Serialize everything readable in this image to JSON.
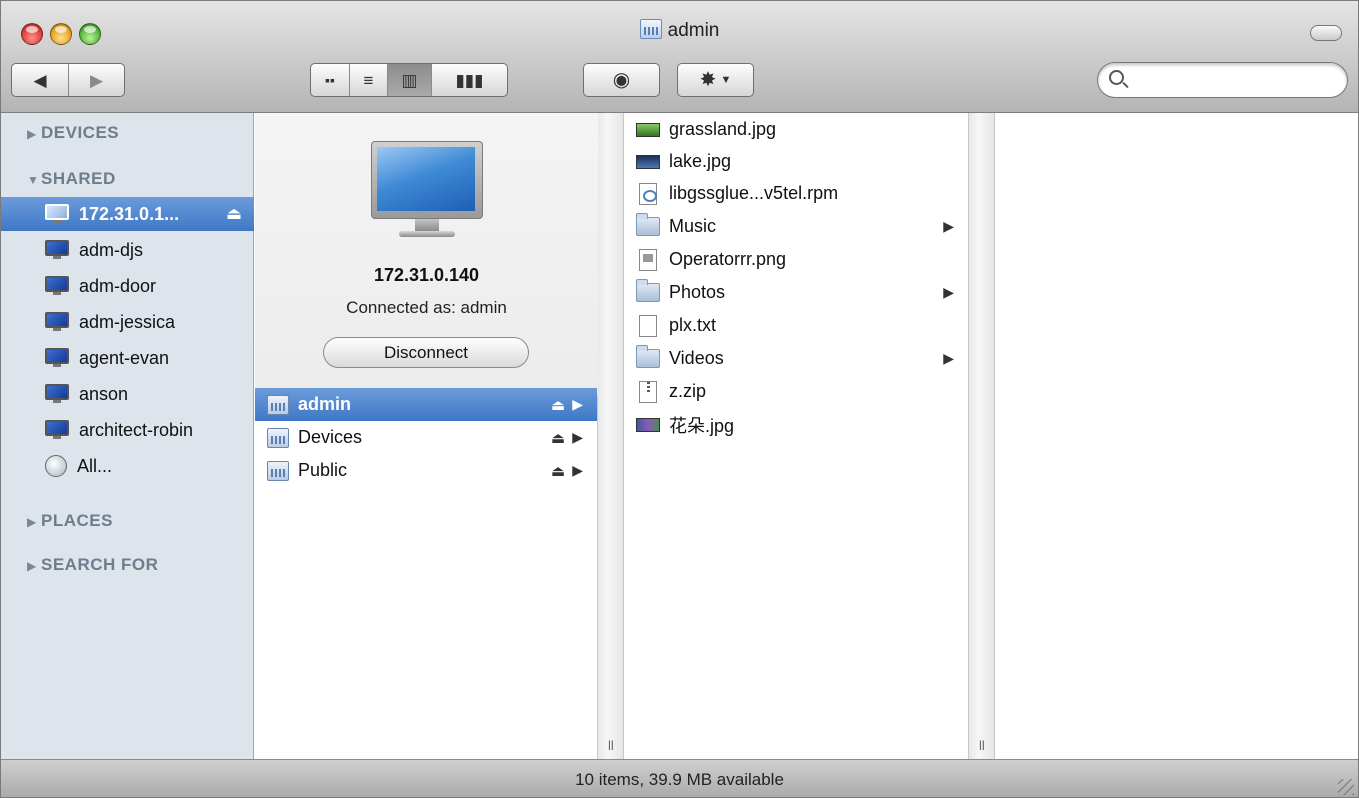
{
  "window": {
    "title": "admin"
  },
  "toolbar": {
    "back_icon": "back-arrow-icon",
    "forward_icon": "forward-arrow-icon",
    "view_icons": [
      "icon-view-icon",
      "list-view-icon",
      "column-view-icon",
      "coverflow-view-icon"
    ],
    "quicklook_icon": "eye-icon",
    "action_icon": "gear-icon",
    "search": {
      "value": "",
      "placeholder": ""
    }
  },
  "sidebar": {
    "sections": {
      "devices": "DEVICES",
      "shared": "SHARED",
      "places": "PLACES",
      "search_for": "SEARCH FOR"
    },
    "shared_items": [
      {
        "label": "172.31.0.1...",
        "selected": true
      },
      {
        "label": "adm-djs"
      },
      {
        "label": "adm-door"
      },
      {
        "label": "adm-jessica"
      },
      {
        "label": "agent-evan"
      },
      {
        "label": "anson"
      },
      {
        "label": "architect-robin"
      },
      {
        "label": "All..."
      }
    ]
  },
  "server": {
    "address": "172.31.0.140",
    "connected_as": "Connected as: admin",
    "disconnect_label": "Disconnect"
  },
  "shares": [
    {
      "label": "admin",
      "selected": true
    },
    {
      "label": "Devices"
    },
    {
      "label": "Public"
    }
  ],
  "files": [
    {
      "label": "grassland.jpg",
      "kind": "image",
      "color": "#3e8a2a"
    },
    {
      "label": "lake.jpg",
      "kind": "image",
      "color": "#1d3f7a"
    },
    {
      "label": "libgssglue...v5tel.rpm",
      "kind": "rpm"
    },
    {
      "label": "Music",
      "kind": "folder"
    },
    {
      "label": "Operatorrr.png",
      "kind": "png"
    },
    {
      "label": "Photos",
      "kind": "folder"
    },
    {
      "label": "plx.txt",
      "kind": "text"
    },
    {
      "label": "Videos",
      "kind": "folder"
    },
    {
      "label": "z.zip",
      "kind": "zip"
    },
    {
      "label": "花朵.jpg",
      "kind": "image",
      "color": "#5a4a8a"
    }
  ],
  "status": {
    "text": "10 items, 39.9 MB available"
  },
  "colors": {
    "selection": "#3f78c8",
    "sidebar_bg": "#dde4ec"
  }
}
